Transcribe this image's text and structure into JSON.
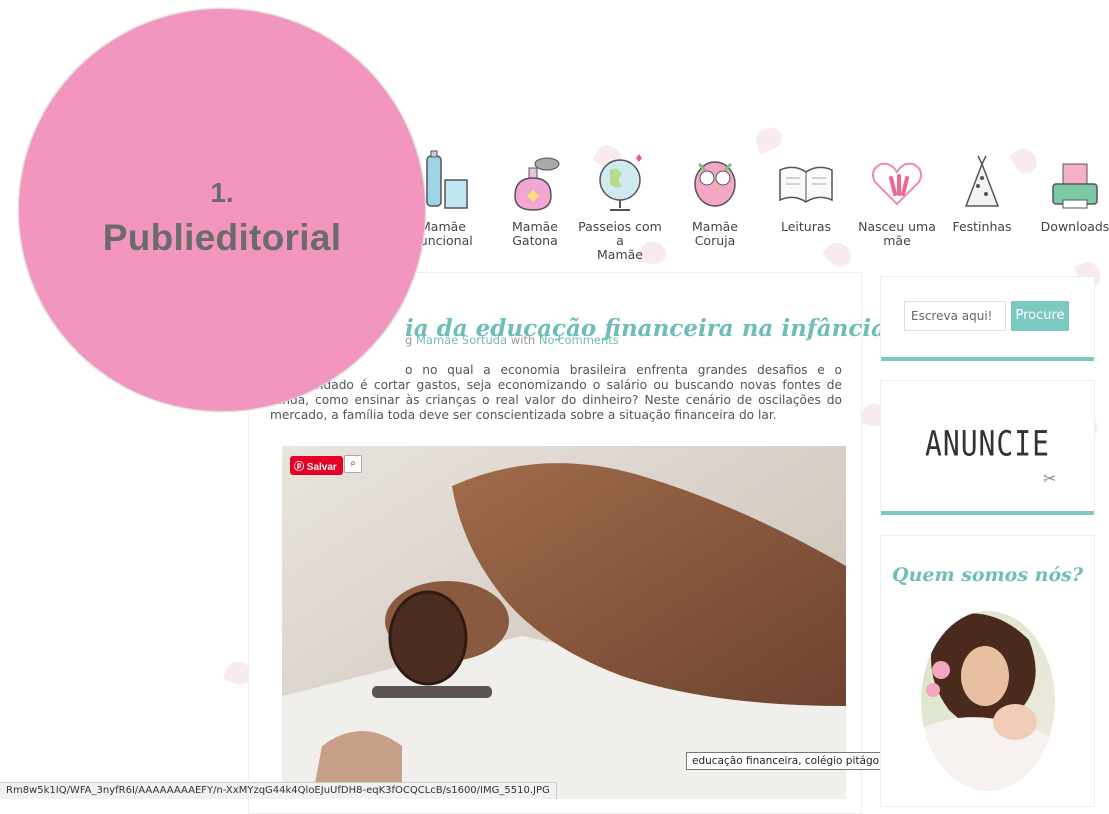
{
  "badge": {
    "number": "1.",
    "label": "Publieditorial"
  },
  "nav": [
    {
      "label": "Mamãe\nFuncional",
      "icon": "bottle-glass-icon"
    },
    {
      "label": "Mamãe\nGatona",
      "icon": "perfume-icon"
    },
    {
      "label": "Passeios com a\nMamãe",
      "icon": "globe-icon"
    },
    {
      "label": "Mamãe\nCoruja",
      "icon": "owl-icon"
    },
    {
      "label": "Leituras",
      "icon": "book-icon"
    },
    {
      "label": "Nasceu uma\nmãe",
      "icon": "heart-hand-icon"
    },
    {
      "label": "Festinhas",
      "icon": "party-hat-icon"
    },
    {
      "label": "Downloads",
      "icon": "printer-icon"
    }
  ],
  "post": {
    "title": "ia da educação financeira na infância",
    "meta_prefix": "g",
    "author": "Mamãe Sortuda",
    "meta_with": "with",
    "comments": "No comments",
    "body": "o no qual a economia brasileira enfrenta grandes desafios e o recomendado é cortar gastos, seja economizando o salário ou buscando novas fontes de renda, como ensinar às crianças o real valor do dinheiro? Neste cenário de oscilações do mercado, a família toda deve ser conscientizada sobre a situação financeira do lar."
  },
  "pinterest": {
    "save_label": "Salvar"
  },
  "tooltip": "educação financeira, colégio pitágoras",
  "status_url": "Rm8w5k1IQ/WFA_3nyfR6I/AAAAAAAAEFY/n-XxMYzqG44k4QloEJuUfDH8-eqK3fOCQCLcB/s1600/IMG_5510.JPG",
  "sidebar": {
    "search_placeholder": "Escreva aqui!",
    "search_button": "Procure",
    "ad_label": "ANUNCIE",
    "about_title": "Quem somos nós?"
  },
  "colors": {
    "accent": "#7cc9c2",
    "badge": "#f296c0",
    "title": "#6fbdb7"
  }
}
